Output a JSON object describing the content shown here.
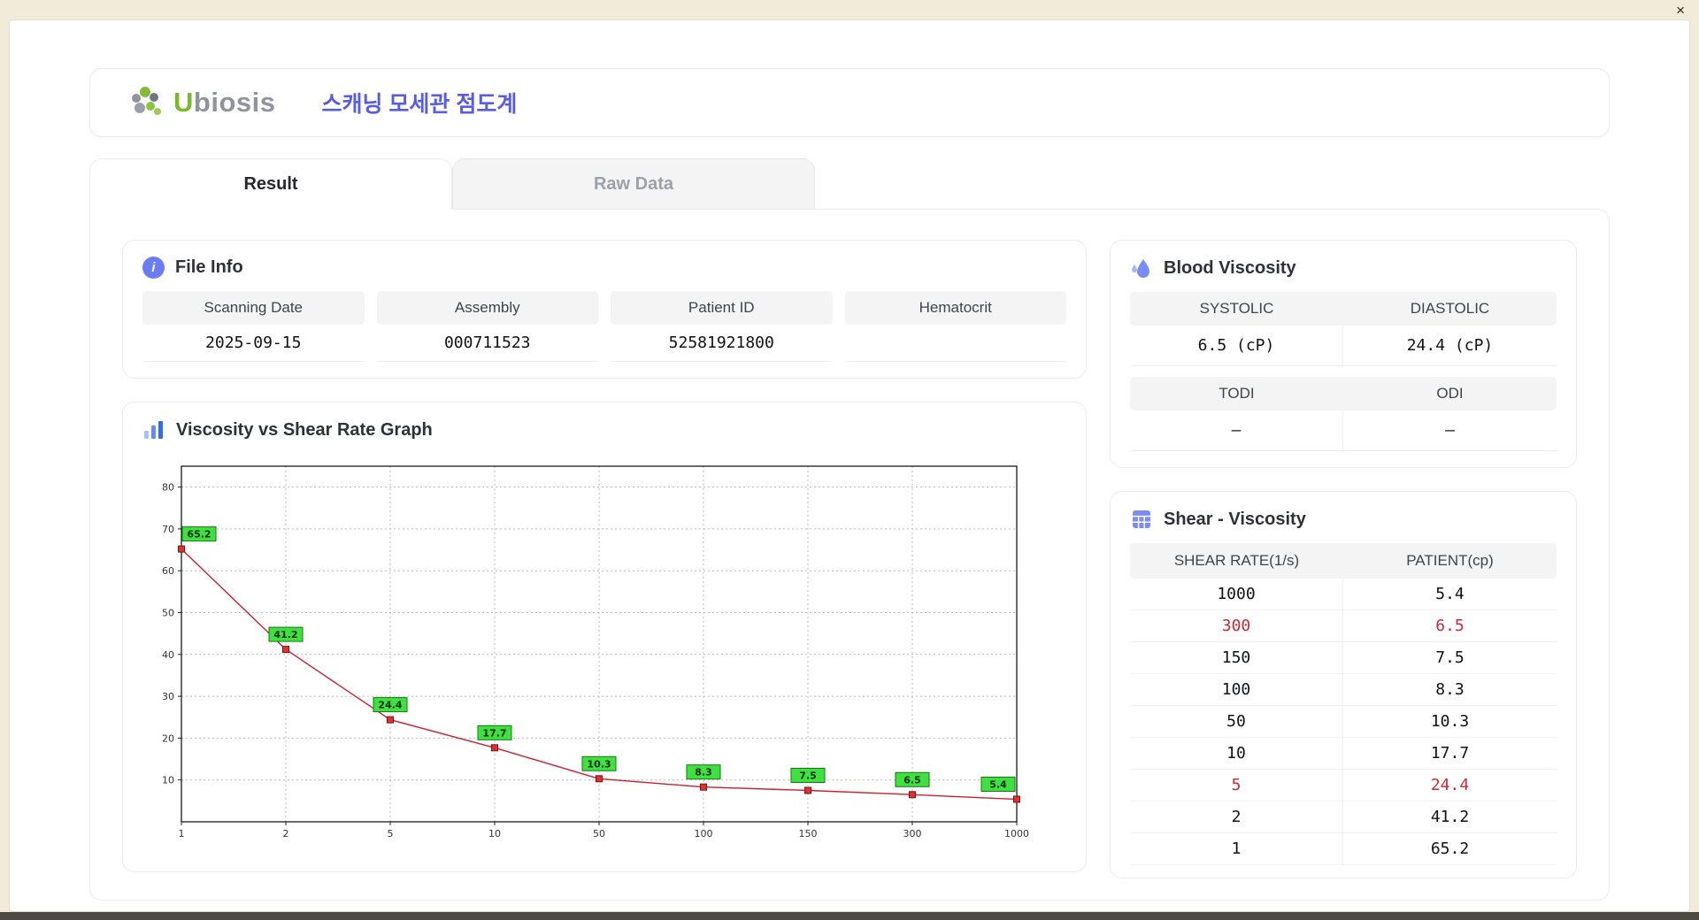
{
  "window": {
    "close_glyph": "×"
  },
  "header": {
    "logo_u": "U",
    "logo_rest": "biosis",
    "title": "스캐닝 모세관 점도계"
  },
  "tabs": [
    {
      "label": "Result",
      "active": true
    },
    {
      "label": "Raw Data",
      "active": false
    }
  ],
  "file_info": {
    "title": "File Info",
    "icon_glyph": "i",
    "fields": [
      {
        "label": "Scanning Date",
        "value": "2025-09-15"
      },
      {
        "label": "Assembly",
        "value": "000711523"
      },
      {
        "label": "Patient ID",
        "value": "52581921800"
      },
      {
        "label": "Hematocrit",
        "value": ""
      }
    ]
  },
  "blood_viscosity": {
    "title": "Blood Viscosity",
    "cells": [
      {
        "label": "SYSTOLIC",
        "value": "6.5 (cP)"
      },
      {
        "label": "DIASTOLIC",
        "value": "24.4 (cP)"
      },
      {
        "label": "TODI",
        "value": "–"
      },
      {
        "label": "ODI",
        "value": "–"
      }
    ]
  },
  "graph": {
    "title": "Viscosity vs Shear Rate Graph"
  },
  "chart_data": {
    "type": "line",
    "title": "Viscosity vs Shear Rate Graph",
    "x_scale": "categorical",
    "x": [
      "1",
      "2",
      "5",
      "10",
      "50",
      "100",
      "150",
      "300",
      "1000"
    ],
    "values": [
      65.2,
      41.2,
      24.4,
      17.7,
      10.3,
      8.3,
      7.5,
      6.5,
      5.4
    ],
    "yticks": [
      10,
      20,
      30,
      40,
      50,
      60,
      70,
      80
    ],
    "ylim": [
      0,
      85
    ],
    "xlabel": "",
    "ylabel": "",
    "grid": true,
    "legend": "none",
    "line_color": "#c8202f",
    "marker_color": "#e03131",
    "point_label_bg": "#3fe03f"
  },
  "shear_table": {
    "title": "Shear - Viscosity",
    "columns": [
      "SHEAR RATE(1/s)",
      "PATIENT(cp)"
    ],
    "highlight_color": "#c92a35",
    "rows": [
      {
        "shear": "1000",
        "patient": "5.4",
        "highlight": false
      },
      {
        "shear": "300",
        "patient": "6.5",
        "highlight": true
      },
      {
        "shear": "150",
        "patient": "7.5",
        "highlight": false
      },
      {
        "shear": "100",
        "patient": "8.3",
        "highlight": false
      },
      {
        "shear": "50",
        "patient": "10.3",
        "highlight": false
      },
      {
        "shear": "10",
        "patient": "17.7",
        "highlight": false
      },
      {
        "shear": "5",
        "patient": "24.4",
        "highlight": true
      },
      {
        "shear": "2",
        "patient": "41.2",
        "highlight": false
      },
      {
        "shear": "1",
        "patient": "65.2",
        "highlight": false
      }
    ]
  }
}
